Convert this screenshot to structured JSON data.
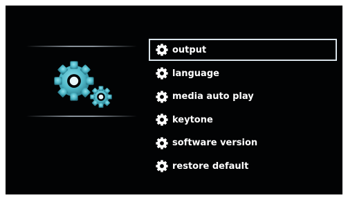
{
  "settings_menu": {
    "header_icon": "settings-gears-icon",
    "item_icon": "gear-icon",
    "accent_color": "#4fb8c8",
    "selected_index": 0,
    "items": [
      {
        "label": "output"
      },
      {
        "label": "language"
      },
      {
        "label": "media auto play"
      },
      {
        "label": "keytone"
      },
      {
        "label": "software version"
      },
      {
        "label": "restore default"
      }
    ]
  }
}
